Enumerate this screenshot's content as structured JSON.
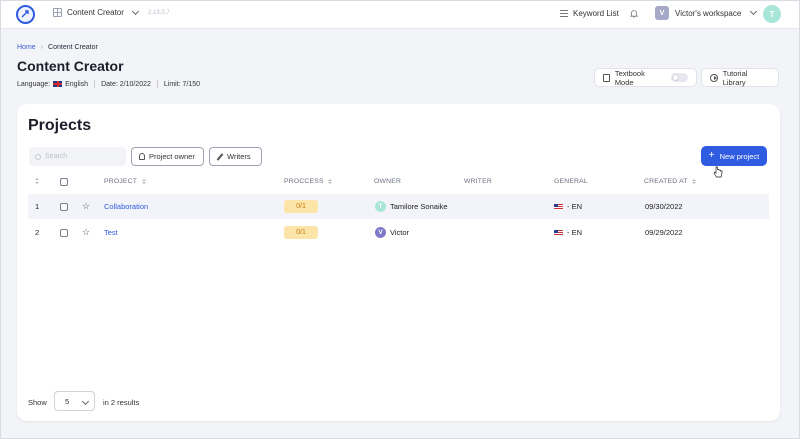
{
  "topbar": {
    "app_name": "Content Creator",
    "version": "2.13.0.7",
    "keyword_list_label": "Keyword List",
    "workspace_initial": "V",
    "workspace_name": "Victor's workspace",
    "user_initial": "T",
    "icons": [
      "logo-icon",
      "grid-icon",
      "list-icon",
      "bell-icon"
    ]
  },
  "breadcrumb": {
    "home": "Home",
    "current": "Content Creator"
  },
  "page": {
    "title": "Content Creator",
    "language_label": "Language:",
    "language_value": "English",
    "date_label": "Date: 2/10/2022",
    "limit_label": "Limit: 7/150"
  },
  "header_actions": {
    "textbook_mode_label": "Textbook Mode",
    "textbook_mode_on": false,
    "tutorial_library_label": "Tutorial Library"
  },
  "projects": {
    "title": "Projects",
    "search_placeholder": "Search",
    "filter_owner_label": "Project owner",
    "filter_writers_label": "Writers",
    "new_project_label": "New project",
    "columns": {
      "project": "PROJECT",
      "process": "PROCCESS",
      "owner": "OWNER",
      "writer": "WRITER",
      "general": "GENERAL",
      "created_at": "CREATED AT"
    },
    "rows": [
      {
        "index": "1",
        "project": "Collaboration",
        "process": "0/1",
        "owner_initial": "T",
        "owner": "Tamilore Sonaike",
        "writer": "",
        "general": "- EN",
        "created_at": "09/30/2022"
      },
      {
        "index": "2",
        "project": "Test",
        "process": "0/1",
        "owner_initial": "V",
        "owner": "Victor",
        "writer": "",
        "general": "- EN",
        "created_at": "09/29/2022"
      }
    ],
    "footer": {
      "show_label": "Show",
      "page_size": "5",
      "results_label": "in 2 results"
    }
  },
  "colors": {
    "primary": "#2f5be0",
    "badge_bg": "#fde4a8",
    "badge_text": "#c47d12",
    "owner_t": "#a9e6da",
    "owner_v": "#7f78c9"
  }
}
